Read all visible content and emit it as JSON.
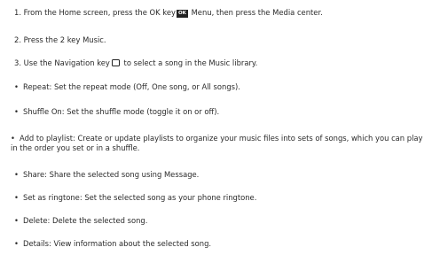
{
  "steps": [
    {
      "before": "1. From the Home screen, press the OK key",
      "key": "OK",
      "after": " Menu, then press the Media center."
    },
    {
      "text": "2. Press the 2 key Music."
    },
    {
      "before": "3. Use the Navigation key",
      "after": " to select a song in the Music library."
    }
  ],
  "options": [
    "Repeat: Set the repeat mode (Off, One song, or All songs).",
    "Shuffle On: Set the shuffle mode (toggle it on or off).",
    "Add to playlist: Create or update playlists to organize your music files into sets of songs, which you can play in the order you set or in a shuffle.",
    "Share: Share the selected song using Message.",
    "Set as ringtone: Set the selected song as your phone ringtone.",
    "Delete: Delete the selected song.",
    "Details: View information about the selected song."
  ],
  "bullet": "•"
}
